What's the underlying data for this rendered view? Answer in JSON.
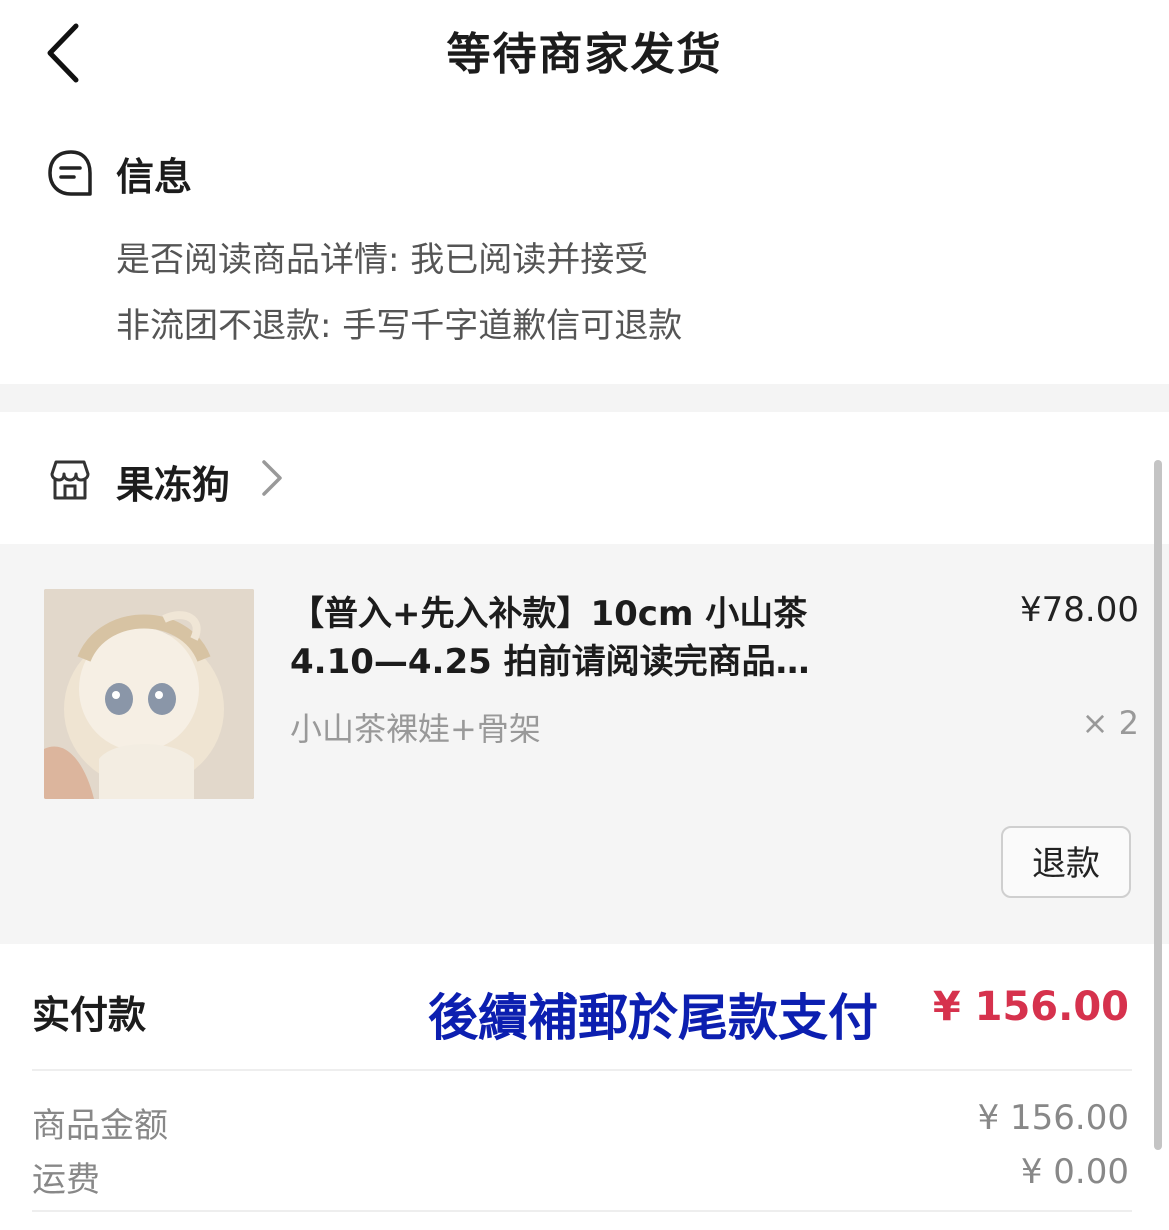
{
  "header": {
    "title": "等待商家发货"
  },
  "info": {
    "title": "信息",
    "lines": [
      "是否阅读商品详情: 我已阅读并接受",
      "非流团不退款: 手写千字道歉信可退款"
    ]
  },
  "shop": {
    "name": "果冻狗"
  },
  "product": {
    "title_line1": "【普入+先入补款】10cm 小山茶",
    "title_line2": "4.10—4.25 拍前请阅读完商品…",
    "price": "¥78.00",
    "spec": "小山茶裸娃+骨架",
    "quantity": "× 2",
    "refund_label": "退款"
  },
  "payment": {
    "paid_label": "实付款",
    "overlay_note": "後續補郵於尾款支付",
    "paid_amount": "¥ 156.00",
    "rows": [
      {
        "label": "商品金额",
        "value": "¥ 156.00"
      },
      {
        "label": "运费",
        "value": "¥ 0.00"
      }
    ]
  },
  "colors": {
    "accent_red": "#d6324d",
    "overlay_blue": "#0c1fb0"
  }
}
